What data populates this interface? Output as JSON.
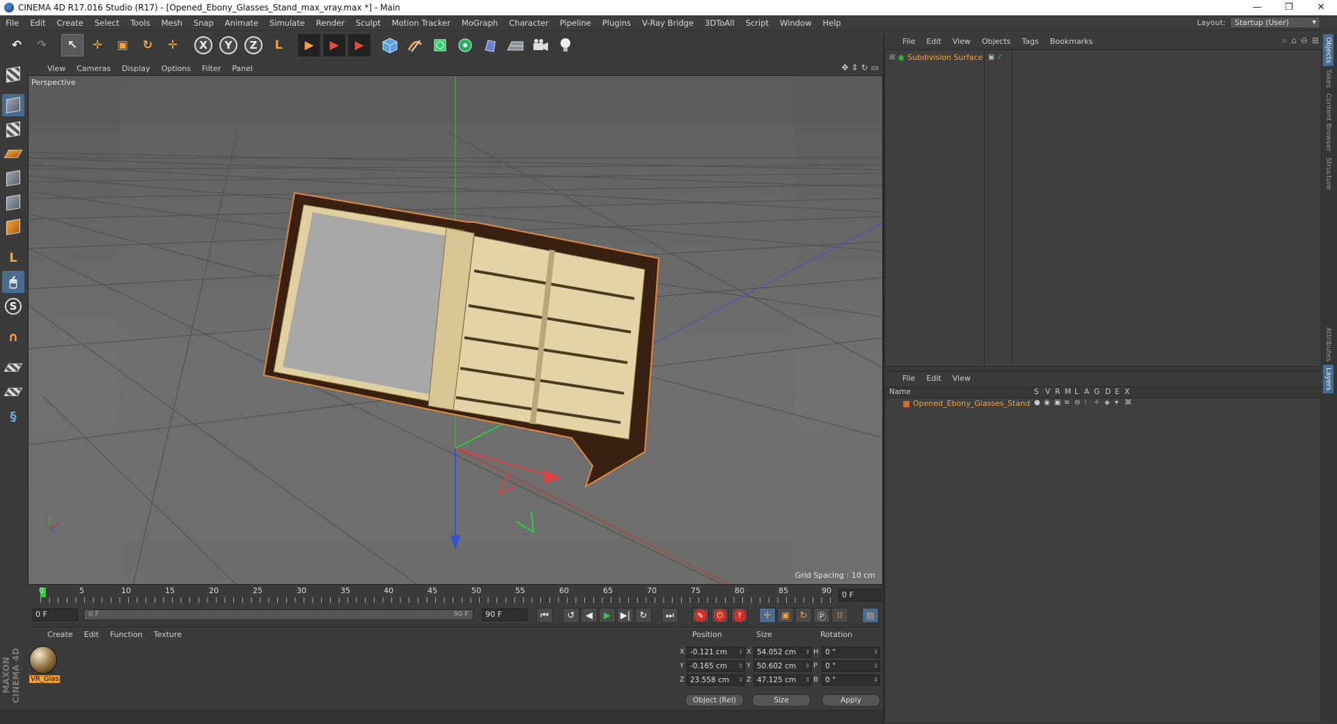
{
  "title": {
    "text": "CINEMA 4D R17.016 Studio (R17) - [Opened_Ebony_Glasses_Stand_max_vray.max *] - Main",
    "minimize": "—",
    "maximize": "❐",
    "close": "✕"
  },
  "menubar": {
    "items": [
      "File",
      "Edit",
      "Create",
      "Select",
      "Tools",
      "Mesh",
      "Snap",
      "Animate",
      "Simulate",
      "Render",
      "Sculpt",
      "Motion Tracker",
      "MoGraph",
      "Character",
      "Pipeline",
      "Plugins",
      "V-Ray Bridge",
      "3DToAll",
      "Script",
      "Window",
      "Help"
    ],
    "layout_label": "Layout:",
    "layout_value": "Startup (User)"
  },
  "toolbar": {
    "undo": "↶",
    "redo": "↷",
    "select": "↖",
    "move": "✛",
    "scale": "▣",
    "rotate": "↻",
    "live": "✛",
    "x": "X",
    "y": "Y",
    "z": "Z",
    "coord": "L",
    "render1": "▶",
    "render2": "▶",
    "render3": "▶"
  },
  "viewport": {
    "menu": [
      "View",
      "Cameras",
      "Display",
      "Options",
      "Filter",
      "Panel"
    ],
    "label": "Perspective",
    "grid_spacing": "Grid Spacing : 10 cm"
  },
  "timeline": {
    "ticks": [
      "0",
      "5",
      "10",
      "15",
      "20",
      "25",
      "30",
      "35",
      "40",
      "45",
      "50",
      "55",
      "60",
      "65",
      "70",
      "75",
      "80",
      "85",
      "90"
    ],
    "current_frame": "0 F",
    "start_field": "0 F",
    "range_start": "0 F",
    "range_end": "90 F",
    "end_field": "90 F"
  },
  "materials": {
    "menu": [
      "Create",
      "Edit",
      "Function",
      "Texture"
    ],
    "items": [
      {
        "name": "VR_Glas"
      }
    ]
  },
  "coordinates": {
    "position_header": "Position",
    "size_header": "Size",
    "rotation_header": "Rotation",
    "rows": [
      {
        "axis": "X",
        "pos": "-0.121 cm",
        "size_axis": "X",
        "size": "54.052 cm",
        "rot_axis": "H",
        "rot": "0 °"
      },
      {
        "axis": "Y",
        "pos": "-0.165 cm",
        "size_axis": "Y",
        "size": "50.602 cm",
        "rot_axis": "P",
        "rot": "0 °"
      },
      {
        "axis": "Z",
        "pos": "23.558 cm",
        "size_axis": "Z",
        "size": "47.125 cm",
        "rot_axis": "B",
        "rot": "0 °"
      }
    ],
    "mode": "Object (Rel)",
    "size_mode": "Size",
    "apply": "Apply"
  },
  "objects_panel": {
    "menu": [
      "File",
      "Edit",
      "View",
      "Objects",
      "Tags",
      "Bookmarks"
    ],
    "items": [
      {
        "name": "Subdivision Surface"
      }
    ]
  },
  "layers_panel": {
    "menu": [
      "File",
      "Edit",
      "View"
    ],
    "columns": {
      "name": "Name",
      "flags": [
        "S",
        "V",
        "R",
        "M",
        "L",
        "A",
        "G",
        "D",
        "E",
        "X"
      ]
    },
    "items": [
      {
        "name": "Opened_Ebony_Glasses_Stand"
      }
    ]
  },
  "right_tabs": [
    "Objects",
    "Takes",
    "Content Browser",
    "Structure",
    "Attributes",
    "Layers"
  ],
  "maxon_logo": "MAXON CINEMA 4D"
}
